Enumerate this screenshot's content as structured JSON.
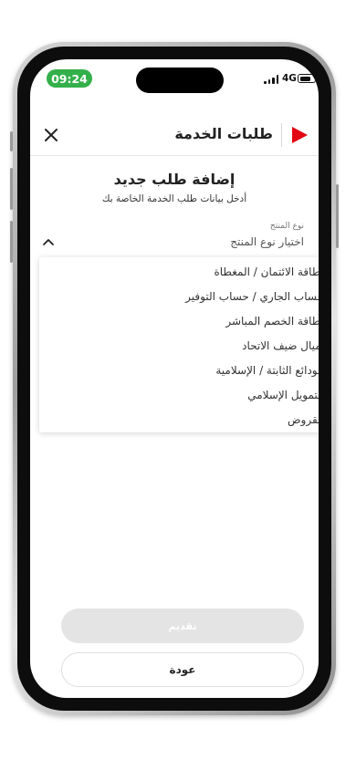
{
  "status_bar": {
    "time": "09:24",
    "network": "4G",
    "battery_level": 0.85
  },
  "header": {
    "title": "طلبات الخدمة",
    "close_icon": "close-icon",
    "brand_color": "#e30613"
  },
  "form": {
    "title": "إضافة طلب جديد",
    "subtitle": "أدخل بيانات طلب الخدمة الخاصة بك",
    "product_type": {
      "label": "نوع المنتج",
      "placeholder": "اختيار نوع المنتج",
      "options": [
        "بطاقة الائتمان / المغطاة",
        "حساب الجاري / حساب التوفير",
        "بطاقة الخصم المباشر",
        "أميال ضيف الاتحاد",
        "الودائع الثابتة / الإسلامية",
        "التمويل الإسلامي",
        "القروض"
      ]
    }
  },
  "buttons": {
    "submit": "تقديم",
    "back": "عودة"
  }
}
